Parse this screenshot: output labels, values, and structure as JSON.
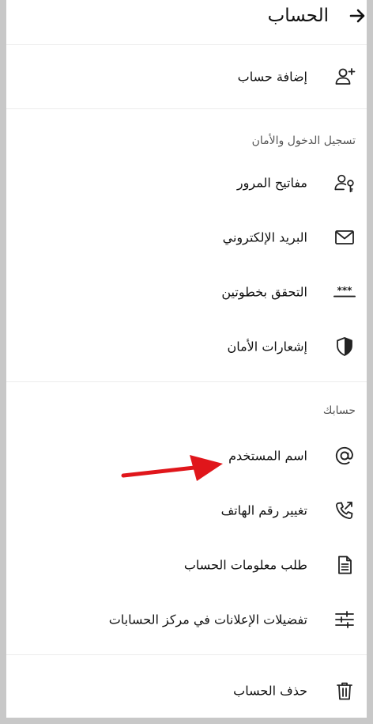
{
  "header": {
    "title": "الحساب"
  },
  "add_account": {
    "label": "إضافة حساب"
  },
  "security": {
    "heading": "تسجيل الدخول والأمان",
    "items": [
      {
        "label": "مفاتيح المرور",
        "icon": "user-key-icon"
      },
      {
        "label": "البريد الإلكتروني",
        "icon": "mail-icon"
      },
      {
        "label": "التحقق بخطوتين",
        "icon": "password-dots-icon"
      },
      {
        "label": "إشعارات الأمان",
        "icon": "shield-icon"
      }
    ]
  },
  "account": {
    "heading": "حسابك",
    "items": [
      {
        "label": "اسم المستخدم",
        "icon": "at-sign-icon"
      },
      {
        "label": "تغيير رقم الهاتف",
        "icon": "phone-swap-icon"
      },
      {
        "label": "طلب معلومات الحساب",
        "icon": "document-icon"
      },
      {
        "label": "تفضيلات الإعلانات في مركز الحسابات",
        "icon": "sliders-icon"
      }
    ]
  },
  "delete_account": {
    "label": "حذف الحساب",
    "icon": "trash-icon"
  },
  "annotation": {
    "color": "#e0161b"
  }
}
